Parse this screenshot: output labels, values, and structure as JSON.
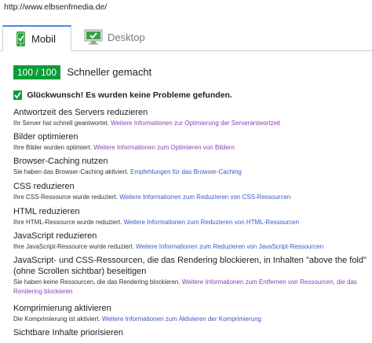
{
  "url": "http://www.elbsenfmedia.de/",
  "tabs": [
    {
      "label": "Mobil",
      "icon": "phone-check-icon",
      "active": true
    },
    {
      "label": "Desktop",
      "icon": "desktop-check-icon",
      "active": false
    }
  ],
  "score": {
    "value": "100 / 100",
    "label": "Schneller gemacht",
    "color": "#0c9d39"
  },
  "congrats": "Glückwunsch! Es wurden keine Probleme gefunden.",
  "rules": [
    {
      "title": "Antwortzeit des Servers reduzieren",
      "desc": "Ihr Server hat schnell geantwortet.",
      "link": "Weitere Informationen zur Optimierung der Serverantwortzeit"
    },
    {
      "title": "Bilder optimieren",
      "desc": "Ihre Bilder wurden optimiert.",
      "link": "Weitere Informationen zum Optimieren von Bildern"
    },
    {
      "title": "Browser-Caching nutzen",
      "desc": "Sie haben das Browser-Caching aktiviert.",
      "link": "Empfehlungen für das Browser-Caching"
    },
    {
      "title": "CSS reduzieren",
      "desc": "Ihre CSS-Ressource wurde reduziert.",
      "link": "Weitere Informationen zum Reduzieren von CSS-Ressourcen"
    },
    {
      "title": "HTML reduzieren",
      "desc": "Ihre HTML-Ressource wurde reduziert.",
      "link": "Weitere Informationen zum Reduzieren von HTML-Ressourcen"
    },
    {
      "title": "JavaScript reduzieren",
      "desc": "Ihre JavaScript-Ressource wurde reduziert.",
      "link": "Weitere Informationen zum Reduzieren von JavaScript-Ressourcen"
    },
    {
      "title": "JavaScript- und CSS-Ressourcen, die das Rendering blockieren, in Inhalten \"above the fold\" (ohne Scrollen sichtbar) beseitigen",
      "desc": "Sie haben keine Ressourcen, die das Rendering blockieren.",
      "link": "Weitere Informationen zum Entfernen von Ressourcen, die das Rendering blockieren"
    },
    {
      "title": "Komprimierung aktivieren",
      "desc": "Die Komprimierung ist aktiviert.",
      "link": "Weitere Informationen zum Aktivieren der Komprimierung"
    },
    {
      "title": "Sichtbare Inhalte priorisieren",
      "desc": "",
      "link": ""
    }
  ]
}
